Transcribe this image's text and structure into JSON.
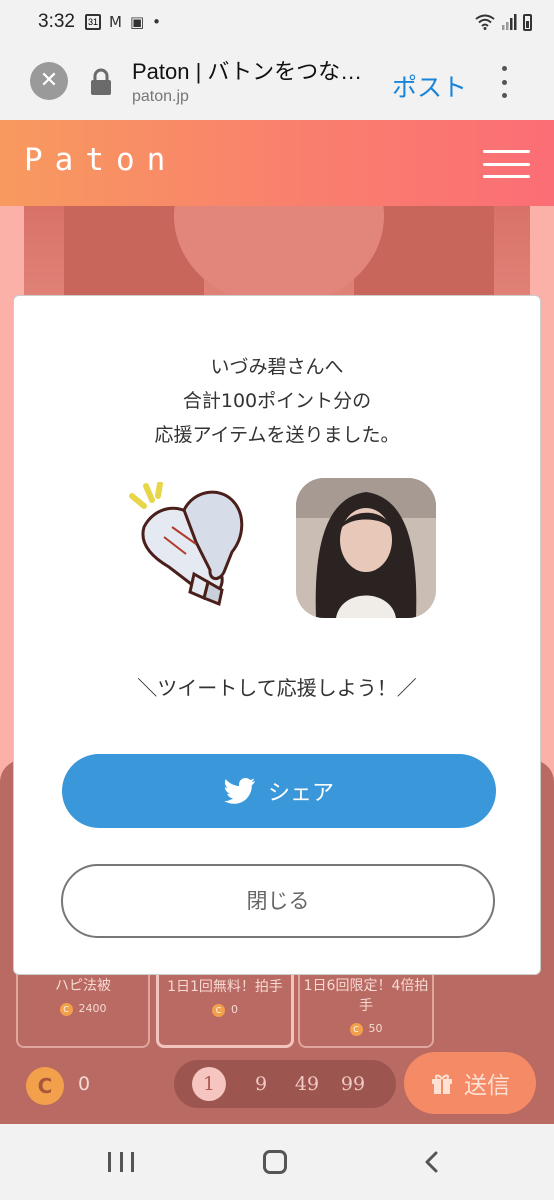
{
  "status_bar": {
    "time": "3:32",
    "calendar_day": "31",
    "icons": [
      "calendar-icon",
      "gmail-icon",
      "gallery-icon",
      "dot-icon",
      "wifi-icon",
      "signal-icon",
      "battery-icon"
    ]
  },
  "browser": {
    "title": "Paton | バトンをつな…",
    "url": "paton.jp",
    "post_label": "ポスト"
  },
  "site": {
    "logo": "Paton"
  },
  "modal": {
    "message_line1": "いづみ碧さんへ",
    "message_line2": "合計100ポイント分の",
    "message_line3": "応援アイテムを送りました。",
    "tweet_prompt": "＼ツイートして応援しよう！／",
    "share_label": "シェア",
    "close_label": "閉じる"
  },
  "items": [
    {
      "name": "ハピ法被",
      "price": "2400"
    },
    {
      "name": "1日1回無料！拍手",
      "price": "0"
    },
    {
      "name": "1日6回限定！4倍拍手",
      "price": "50"
    }
  ],
  "footer": {
    "coin_symbol": "C",
    "balance": "0",
    "counts": [
      "1",
      "9",
      "49",
      "99"
    ],
    "selected_count": "1",
    "send_label": "送信"
  },
  "colors": {
    "header_gradient_start": "#f89a5f",
    "header_gradient_end": "#fb6e75",
    "share_button": "#3a97d9",
    "coin": "#f3a04c",
    "post_link": "#1a85d8"
  }
}
